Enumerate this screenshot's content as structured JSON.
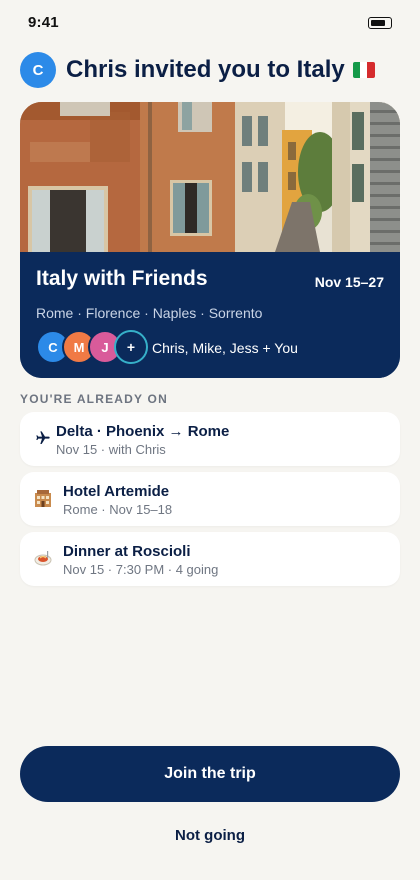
{
  "status_bar": {
    "time": "9:41",
    "battery_level": 0.85
  },
  "header": {
    "avatar_initial": "C",
    "title": "Chris invited you to Italy",
    "flag_icon": "italy-flag"
  },
  "trip": {
    "name": "Italy with Friends",
    "dates": "Nov 15–27",
    "cities": "Rome · Florence · Naples · Sorrento",
    "members_text": "Chris, Mike, Jess + You",
    "member_avatars": [
      {
        "initial": "C",
        "color": "#2c8ae8"
      },
      {
        "initial": "M",
        "color": "#f07a45"
      },
      {
        "initial": "J",
        "color": "#d95b9a"
      }
    ],
    "add_member_glyph": "+"
  },
  "section_label": "YOU'RE ALREADY ON",
  "bookings": [
    {
      "icon": "airplane-icon",
      "title": "Delta · Phoenix → Rome",
      "subtitle": "Nov 15 · with Chris"
    },
    {
      "icon": "hotel-icon",
      "title": "Hotel Artemide",
      "subtitle": "Rome · Nov 15–18"
    },
    {
      "icon": "restaurant-icon",
      "title": "Dinner at Roscioli",
      "subtitle": "Nov 15 · 7:30 PM · 4 going"
    }
  ],
  "actions": {
    "join_label": "Join the trip",
    "decline_label": "Not going"
  },
  "colors": {
    "primary": "#0b2a5b",
    "background": "#f6f5f1",
    "accent_ring": "#36b0c9"
  }
}
